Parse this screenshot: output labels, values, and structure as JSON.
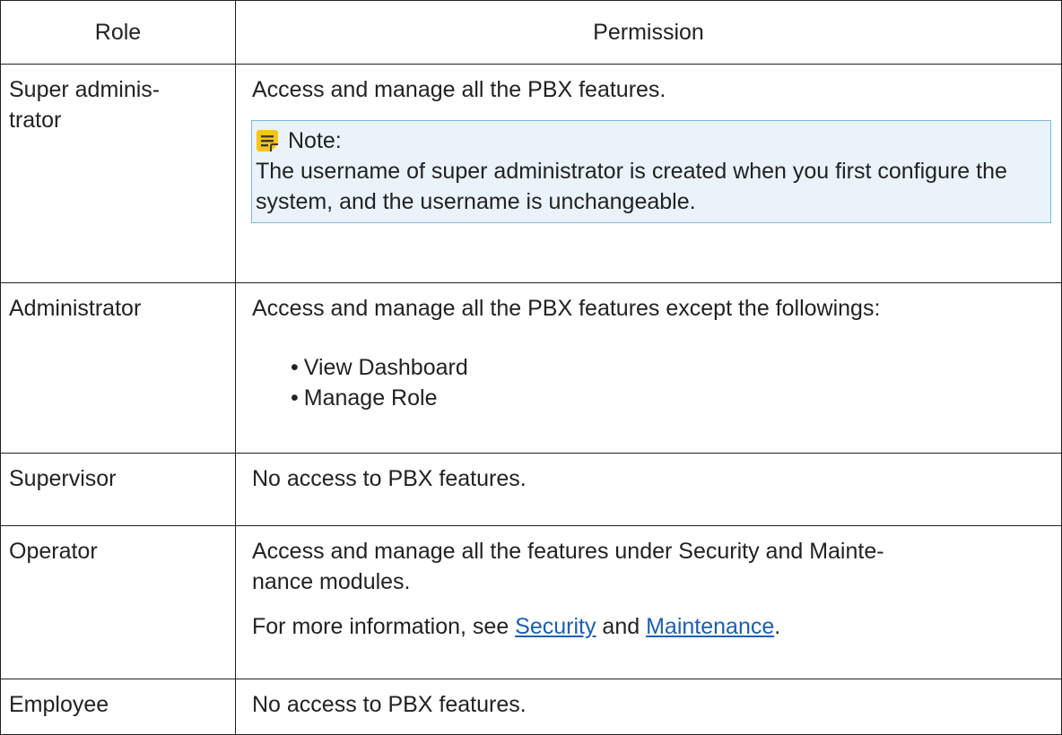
{
  "table": {
    "headers": {
      "role": "Role",
      "permission": "Permission"
    },
    "rows": [
      {
        "role": "Super adminis-\ntrator",
        "permission": "Access and manage all the PBX features.",
        "note": {
          "icon": "note-icon",
          "title": "Note:",
          "text": "The username of super administrator is created when you first configure the system, and the username is unchangeable."
        }
      },
      {
        "role": "Administrator",
        "permission": "Access and manage all the PBX features except the followings:",
        "bullets": [
          "View Dashboard",
          "Manage Role"
        ]
      },
      {
        "role": "Supervisor",
        "permission": "No access to PBX features."
      },
      {
        "role": "Operator",
        "permission": "Access and manage all the features under Security and Mainte-\nnance modules.",
        "more_info": {
          "prefix": "For more information, see ",
          "link1": "Security",
          "middle": " and ",
          "link2": "Maintenance",
          "suffix": "."
        }
      },
      {
        "role": "Employee",
        "permission": "No access to PBX features."
      }
    ]
  },
  "colors": {
    "note_background": "#e9f3f9",
    "note_border": "#7dbad9",
    "note_icon": "#f5c518",
    "link": "#1a5fb4"
  }
}
